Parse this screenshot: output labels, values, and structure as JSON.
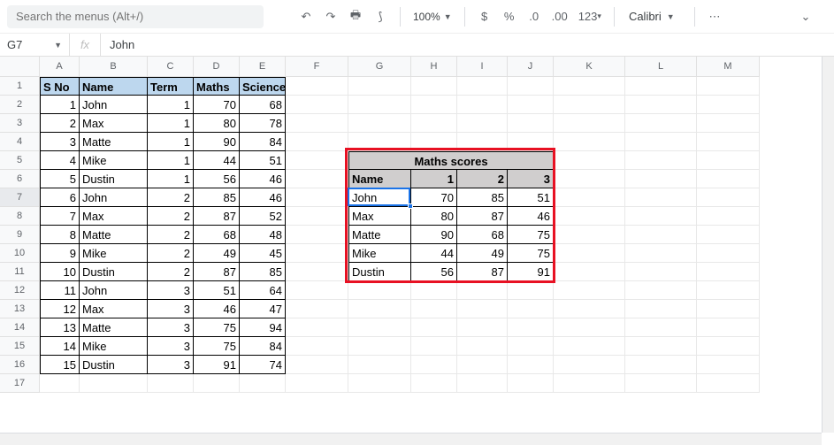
{
  "toolbar": {
    "search_placeholder": "Search the menus (Alt+/)",
    "zoom": "100%",
    "font": "Calibri",
    "fmt_currency": "$",
    "fmt_percent": "%",
    "fmt_dec_dec": ".0",
    "fmt_dec_inc": ".00",
    "fmt_123": "123"
  },
  "namebox": {
    "cell_ref": "G7",
    "fx": "fx",
    "formula": "John"
  },
  "columns": [
    {
      "l": "A",
      "w": 45
    },
    {
      "l": "B",
      "w": 77
    },
    {
      "l": "C",
      "w": 52
    },
    {
      "l": "D",
      "w": 52
    },
    {
      "l": "E",
      "w": 52
    },
    {
      "l": "F",
      "w": 71
    },
    {
      "l": "G",
      "w": 71
    },
    {
      "l": "H",
      "w": 52
    },
    {
      "l": "I",
      "w": 57
    },
    {
      "l": "J",
      "w": 52
    },
    {
      "l": "K",
      "w": 81
    },
    {
      "l": "L",
      "w": 81
    },
    {
      "l": "M",
      "w": 71
    }
  ],
  "row_count": 17,
  "active_row": 7,
  "main_table": {
    "headers": {
      "sno": "S No",
      "name": "Name",
      "term": "Term",
      "maths": "Maths",
      "science": "Science"
    },
    "rows": [
      {
        "sno": "1",
        "name": "John",
        "term": "1",
        "maths": "70",
        "science": "68"
      },
      {
        "sno": "2",
        "name": "Max",
        "term": "1",
        "maths": "80",
        "science": "78"
      },
      {
        "sno": "3",
        "name": "Matte",
        "term": "1",
        "maths": "90",
        "science": "84"
      },
      {
        "sno": "4",
        "name": "Mike",
        "term": "1",
        "maths": "44",
        "science": "51"
      },
      {
        "sno": "5",
        "name": "Dustin",
        "term": "1",
        "maths": "56",
        "science": "46"
      },
      {
        "sno": "6",
        "name": "John",
        "term": "2",
        "maths": "85",
        "science": "46"
      },
      {
        "sno": "7",
        "name": "Max",
        "term": "2",
        "maths": "87",
        "science": "52"
      },
      {
        "sno": "8",
        "name": "Matte",
        "term": "2",
        "maths": "68",
        "science": "48"
      },
      {
        "sno": "9",
        "name": "Mike",
        "term": "2",
        "maths": "49",
        "science": "45"
      },
      {
        "sno": "10",
        "name": "Dustin",
        "term": "2",
        "maths": "87",
        "science": "85"
      },
      {
        "sno": "11",
        "name": "John",
        "term": "3",
        "maths": "51",
        "science": "64"
      },
      {
        "sno": "12",
        "name": "Max",
        "term": "3",
        "maths": "46",
        "science": "47"
      },
      {
        "sno": "13",
        "name": "Matte",
        "term": "3",
        "maths": "75",
        "science": "94"
      },
      {
        "sno": "14",
        "name": "Mike",
        "term": "3",
        "maths": "75",
        "science": "84"
      },
      {
        "sno": "15",
        "name": "Dustin",
        "term": "3",
        "maths": "91",
        "science": "74"
      }
    ]
  },
  "pivot": {
    "title": "Maths scores",
    "headers": {
      "name": "Name",
      "c1": "1",
      "c2": "2",
      "c3": "3"
    },
    "rows": [
      {
        "name": "John",
        "c1": "70",
        "c2": "85",
        "c3": "51"
      },
      {
        "name": "Max",
        "c1": "80",
        "c2": "87",
        "c3": "46"
      },
      {
        "name": "Matte",
        "c1": "90",
        "c2": "68",
        "c3": "75"
      },
      {
        "name": "Mike",
        "c1": "44",
        "c2": "49",
        "c3": "75"
      },
      {
        "name": "Dustin",
        "c1": "56",
        "c2": "87",
        "c3": "91"
      }
    ]
  }
}
